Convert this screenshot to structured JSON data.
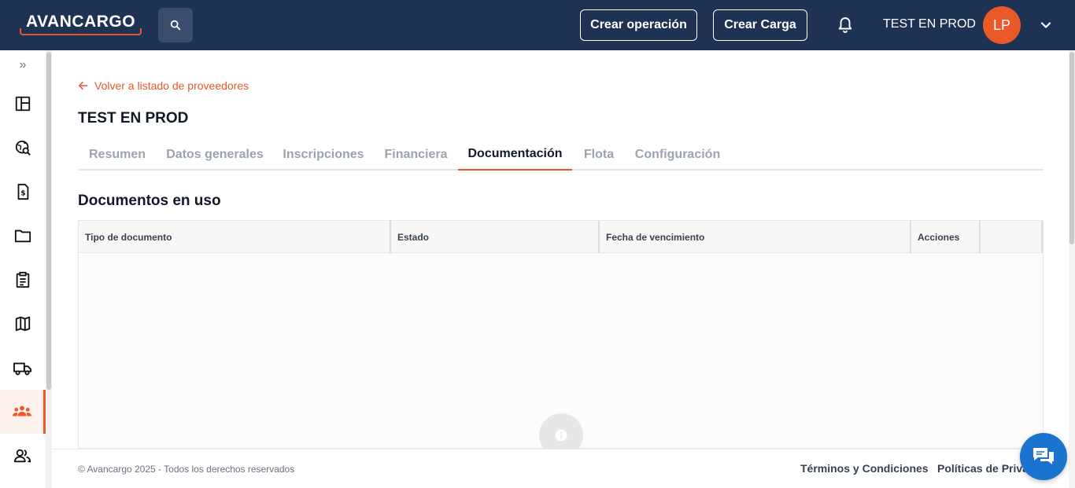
{
  "header": {
    "logo_text": "AVANCARGO",
    "create_operation_label": "Crear operación",
    "create_load_label": "Crear Carga",
    "user_name": "TEST EN PROD",
    "avatar_initials": "LP",
    "brand_color": "#1e3354",
    "accent_color": "#ea5a28"
  },
  "sidebar": {
    "expand_label": "»",
    "items": [
      {
        "icon": "dashboard-icon"
      },
      {
        "icon": "globe-search-icon"
      },
      {
        "icon": "invoice-icon"
      },
      {
        "icon": "folder-icon"
      },
      {
        "icon": "clipboard-icon"
      },
      {
        "icon": "map-icon"
      },
      {
        "icon": "truck-icon"
      },
      {
        "icon": "group-icon",
        "active": true
      },
      {
        "icon": "users-icon"
      }
    ]
  },
  "main": {
    "back_link": "Volver a listado de proveedores",
    "title": "TEST EN PROD",
    "tabs": [
      {
        "label": "Resumen"
      },
      {
        "label": "Datos generales"
      },
      {
        "label": "Inscripciones"
      },
      {
        "label": "Financiera"
      },
      {
        "label": "Documentación",
        "active": true
      },
      {
        "label": "Flota"
      },
      {
        "label": "Configuración"
      }
    ],
    "section_title": "Documentos en uso",
    "table": {
      "columns": [
        "Tipo de documento",
        "Estado",
        "Fecha de vencimiento",
        "Acciones",
        ""
      ],
      "rows": []
    }
  },
  "footer": {
    "copyright": "© Avancargo 2025 - Todos los derechos reservados",
    "terms": "Términos y Condiciones",
    "privacy": "Políticas de Priva"
  }
}
